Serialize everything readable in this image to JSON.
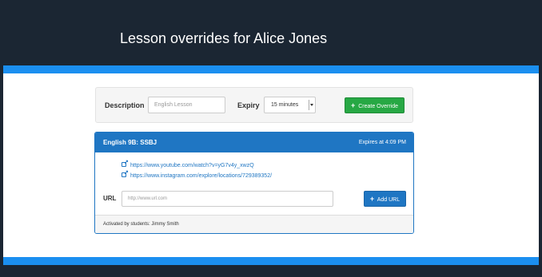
{
  "header": {
    "title": "Lesson overrides for Alice Jones"
  },
  "colors": {
    "header_bg": "#1b2633",
    "accent_stripe": "#1b8ff0",
    "primary": "#1f76c3",
    "success": "#27a844"
  },
  "form": {
    "description_label": "Description",
    "description_placeholder": "English Lesson",
    "description_value": "",
    "expiry_label": "Expiry",
    "expiry_selected": "15 minutes",
    "create_icon": "plus-icon",
    "create_label": "Create Override"
  },
  "override": {
    "name": "English 9B: SSBJ",
    "expires": "Expires at 4:09 PM",
    "link_icon": "external-link-icon",
    "links": [
      "https://www.youtube.com/watch?v=yG7v4y_xwzQ",
      "https://www.instagram.com/explore/locations/729389352/"
    ],
    "url_label": "URL",
    "url_placeholder": "http://www.url.com",
    "add_icon": "plus-icon",
    "add_url_label": "Add URL",
    "footer": "Activated by students: Jimmy Smith"
  }
}
